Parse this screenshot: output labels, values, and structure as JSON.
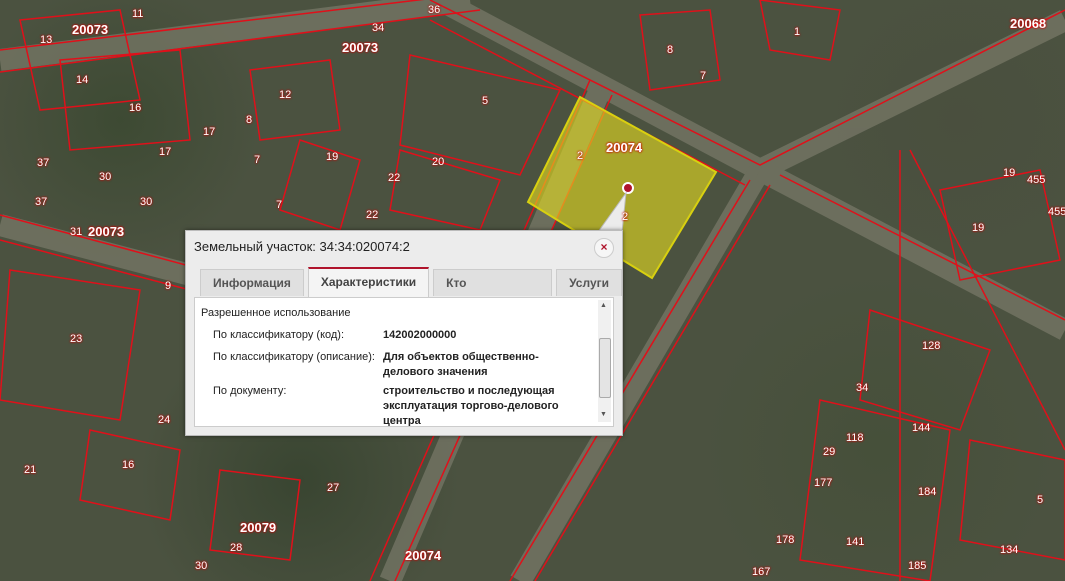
{
  "popup": {
    "title": "Земельный участок: 34:34:020074:2",
    "close": "×",
    "tabs": [
      "Информация",
      "Характеристики",
      "Кто обслуживает?",
      "Услуги"
    ],
    "active_tab": "Характеристики",
    "section": "Разрешенное использование",
    "rows": [
      {
        "label": "По классификатору (код):",
        "value": "142002000000"
      },
      {
        "label": "По классификатору (описание):",
        "value": "Для объектов общественно-делового значения"
      },
      {
        "label": "По документу:",
        "value": "строительство и последующая эксплуатация торгово-делового центра"
      }
    ],
    "scroll_up": "▲",
    "scroll_down": "▼"
  },
  "map": {
    "highlight_color": "#e8e020",
    "boundary_color": "#e0101a",
    "labels": [
      "11",
      "20073",
      "13",
      "34",
      "20073",
      "36",
      "8",
      "1",
      "20068",
      "14",
      "12",
      "5",
      "7",
      "16",
      "17",
      "8",
      "2",
      "20074",
      "37",
      "30",
      "7",
      "17",
      "19",
      "20",
      "22",
      "37",
      "30",
      "31",
      "20073",
      "7",
      "2",
      "19",
      "455",
      "455",
      "19",
      "22",
      "128",
      "23",
      "34",
      "144",
      "118",
      "29",
      "177",
      "184",
      "5",
      "21",
      "16",
      "24",
      "27",
      "20079",
      "20074",
      "28",
      "141",
      "178",
      "134",
      "185",
      "167",
      "30",
      "9"
    ]
  }
}
